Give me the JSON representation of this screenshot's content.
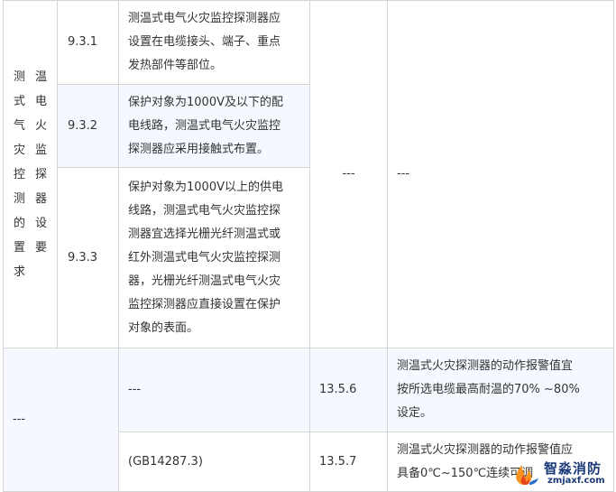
{
  "table": {
    "category": {
      "col_left": [
        "测",
        "式",
        "气",
        "灾",
        "控",
        "测",
        "的",
        "置",
        "求"
      ],
      "col_right": [
        "温",
        "电",
        "火",
        "监",
        "探",
        "器",
        "设",
        "要",
        ""
      ]
    },
    "rows": [
      {
        "code_a": "9.3.1",
        "text_a": [
          "测温式电气火灾监控探测器应",
          "设置在电缆接头、端子、重点",
          "发热部件等部位。"
        ]
      },
      {
        "code_a": "9.3.2",
        "text_a": [
          "保护对象为1000V及以下的配",
          "电线路，测温式电气火灾监控",
          "探测器应采用接触式布置。"
        ]
      },
      {
        "code_a": "9.3.3",
        "text_a": [
          "保护对象为1000V以上的供电",
          "线路，测温式电气火灾监控探",
          "测器宜选择光栅光纤测温式或",
          "红外测温式电气火灾监控探测",
          "器，光栅光纤测温式电气火灾",
          "监控探测器应直接设置在保护",
          "对象的表面。"
        ]
      }
    ],
    "merged_dash_code_b": "---",
    "merged_dash_text_b": "---",
    "lower": {
      "dash_cat": "---",
      "rows": [
        {
          "text_a": "---",
          "code_b": "13.5.6",
          "text_b": [
            "测温式火灾探测器的动作报警值宜",
            "按所选电缆最高耐温的70% ~80%",
            "设定。"
          ]
        },
        {
          "text_a": "(GB14287.3)",
          "code_b": "13.5.7",
          "text_b": [
            "测温式火灾探测器的动作报警值应",
            "具备0℃~150℃连续可调"
          ]
        }
      ]
    }
  },
  "watermark": {
    "name": "智淼消防",
    "url": "zmjaxf.com",
    "icon": "flame-logo-icon",
    "color": "#1a3a7a"
  }
}
